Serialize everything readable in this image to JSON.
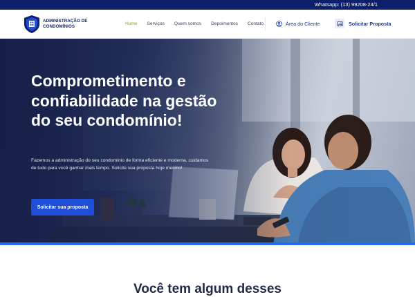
{
  "topbar": {
    "whatsapp": "Whatsapp: (13) 99208-24/1"
  },
  "header": {
    "logo_text": [
      "ADMINISTRAÇÃO DE",
      "CONDOMÍNIOS"
    ],
    "nav": [
      "Home",
      "Serviços",
      "Quem somos",
      "Depoimentos",
      "Contato"
    ],
    "client_area": "Área do Cliente",
    "request_proposal": "Solicitar Proposta"
  },
  "hero": {
    "title": "Comprometimento e confiabilidade na gestão do seu condomínio!",
    "subtitle": "Fazemos a administração do seu condomínio de forma eficiente e moderna, cuidamos de tudo para você ganhar mais tempo. Solicite sua proposta hoje mesmo!",
    "cta": "Solicitar sua proposta"
  },
  "section": {
    "title": "Você tem algum desses"
  },
  "colors": {
    "primary": "#0b1f6b",
    "accent": "#1f4fd8",
    "nav_active": "#8a9b2a"
  }
}
